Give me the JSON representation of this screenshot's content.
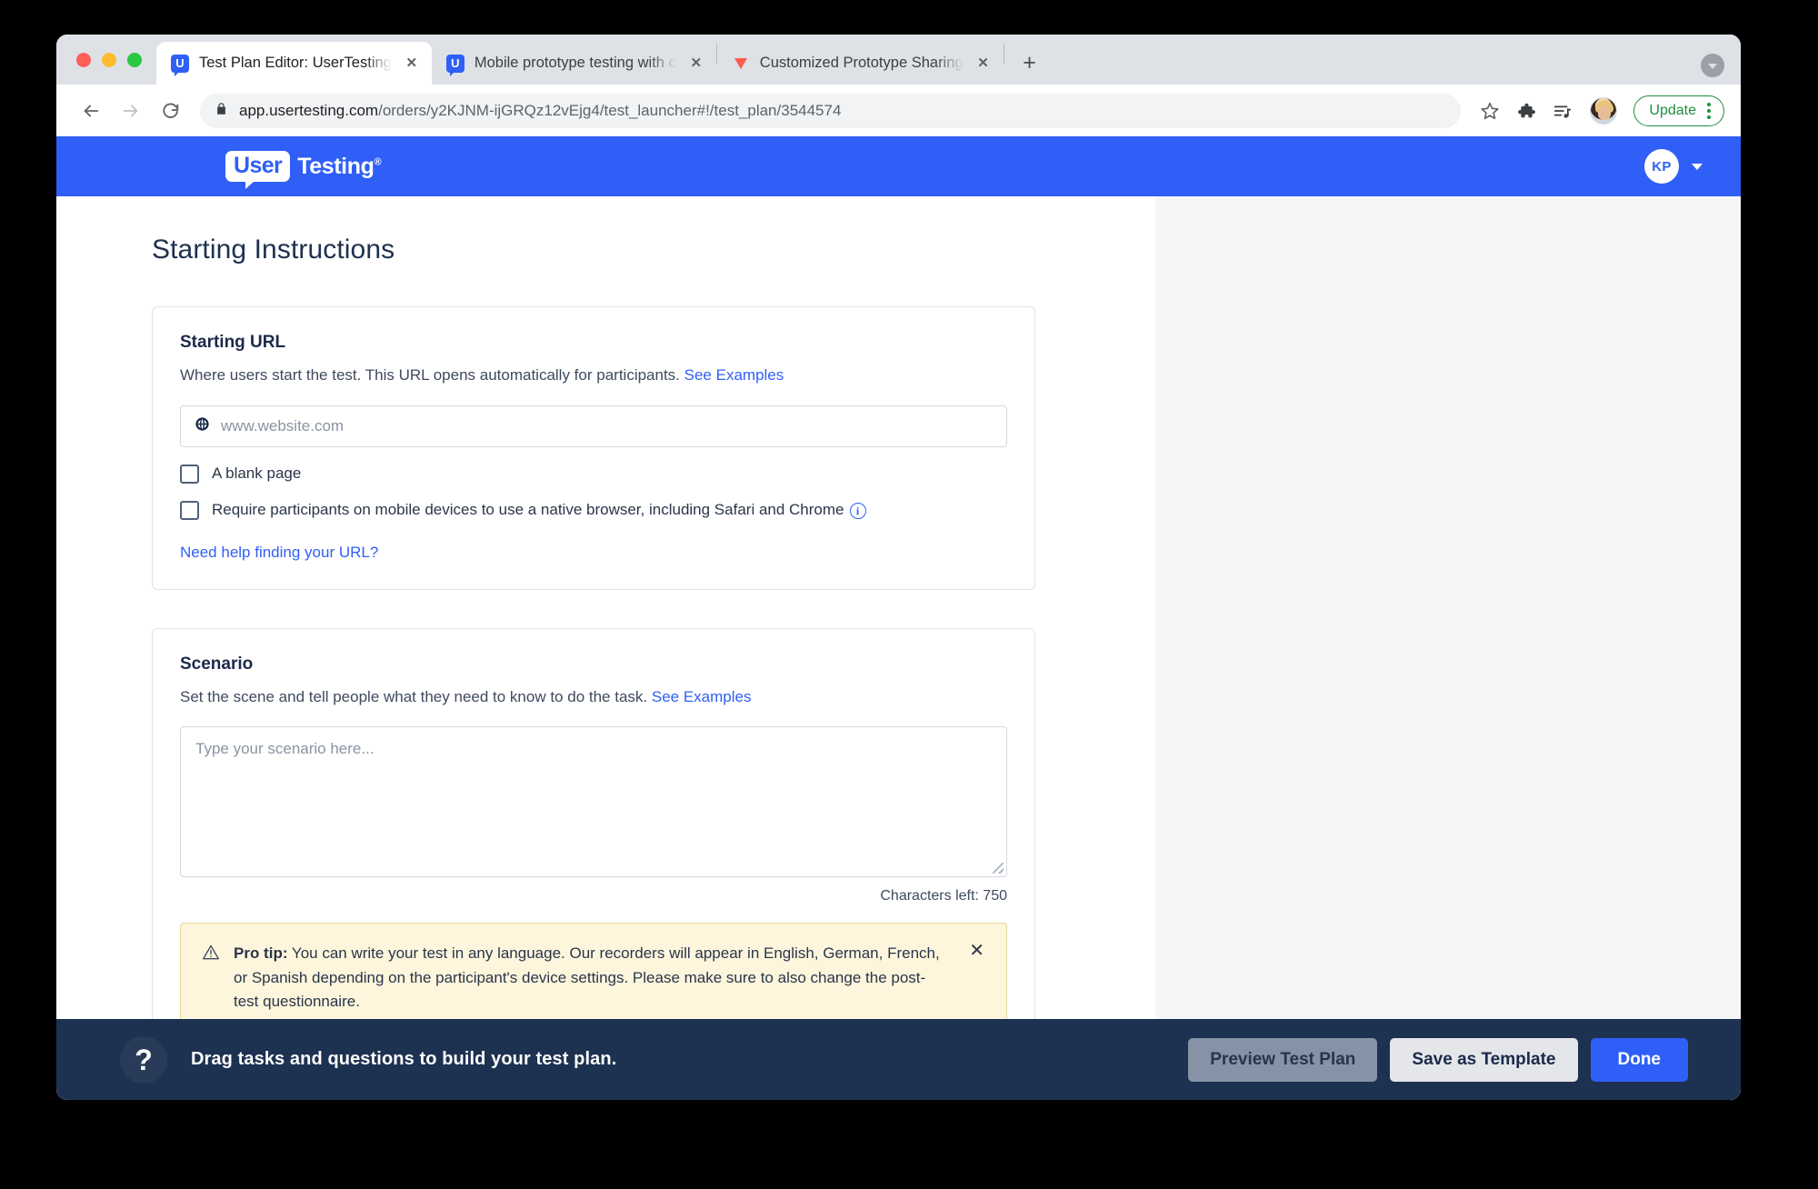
{
  "browser": {
    "tabs": [
      {
        "title": "Test Plan Editor: UserTesting",
        "favicon": "usertesting-favicon",
        "active": true,
        "close_label": "✕"
      },
      {
        "title": "Mobile prototype testing with c",
        "favicon": "usertesting-favicon",
        "active": false,
        "close_label": "✕"
      },
      {
        "title": "Customized Prototype Sharing",
        "favicon": "invision-triangle-favicon",
        "active": false,
        "close_label": "✕"
      }
    ],
    "new_tab_label": "+",
    "nav": {
      "back": "←",
      "forward": "→",
      "reload": "↻"
    },
    "omnibox": {
      "lock_icon": "lock-icon",
      "url_domain": "app.usertesting.com",
      "url_path": "/orders/y2KJNM-ijGRQz12vEjg4/test_launcher#!/test_plan/3544574"
    },
    "toolbar_icons": [
      "bookmark-star-icon",
      "extensions-puzzle-icon",
      "media-playlist-icon"
    ],
    "profile_avatar": "user-avatar-photo",
    "update_button": {
      "label": "Update",
      "color": "#1e8e3e"
    },
    "menu_icon": "kebab-menu-icon"
  },
  "app_header": {
    "logo_bubble_text": "User",
    "logo_word": "Testing",
    "logo_registered": "®",
    "brand_color": "#2f5ff6",
    "account_initials": "KP",
    "account_caret": "chevron-down-icon"
  },
  "page": {
    "title": "Starting Instructions"
  },
  "starting_url_card": {
    "heading": "Starting URL",
    "description": "Where users start the test. This URL opens automatically for participants.",
    "see_examples": "See Examples",
    "input": {
      "icon": "globe-icon",
      "placeholder": "www.website.com",
      "value": ""
    },
    "checkboxes": [
      {
        "label": "A blank page",
        "checked": false,
        "info": false
      },
      {
        "label": "Require participants on mobile devices to use a native browser, including Safari and Chrome",
        "checked": false,
        "info": true
      }
    ],
    "help_link": "Need help finding your URL?"
  },
  "scenario_card": {
    "heading": "Scenario",
    "description": "Set the scene and tell people what they need to know to do the task.",
    "see_examples": "See Examples",
    "textarea": {
      "placeholder": "Type your scenario here...",
      "value": ""
    },
    "characters_left": "Characters left: 750",
    "protip": {
      "icon": "warning-triangle-icon",
      "label": "Pro tip:",
      "text": " You can write your test in any language. Our recorders will appear in English, German, French, or Spanish depending on the participant's device settings. Please make sure to also change the post-test questionnaire.",
      "close": "✕"
    }
  },
  "footer": {
    "help_icon": "question-mark-icon",
    "message": "Drag tasks and questions to build your test plan.",
    "buttons": {
      "preview": "Preview Test Plan",
      "save_template": "Save as Template",
      "done": "Done"
    }
  }
}
